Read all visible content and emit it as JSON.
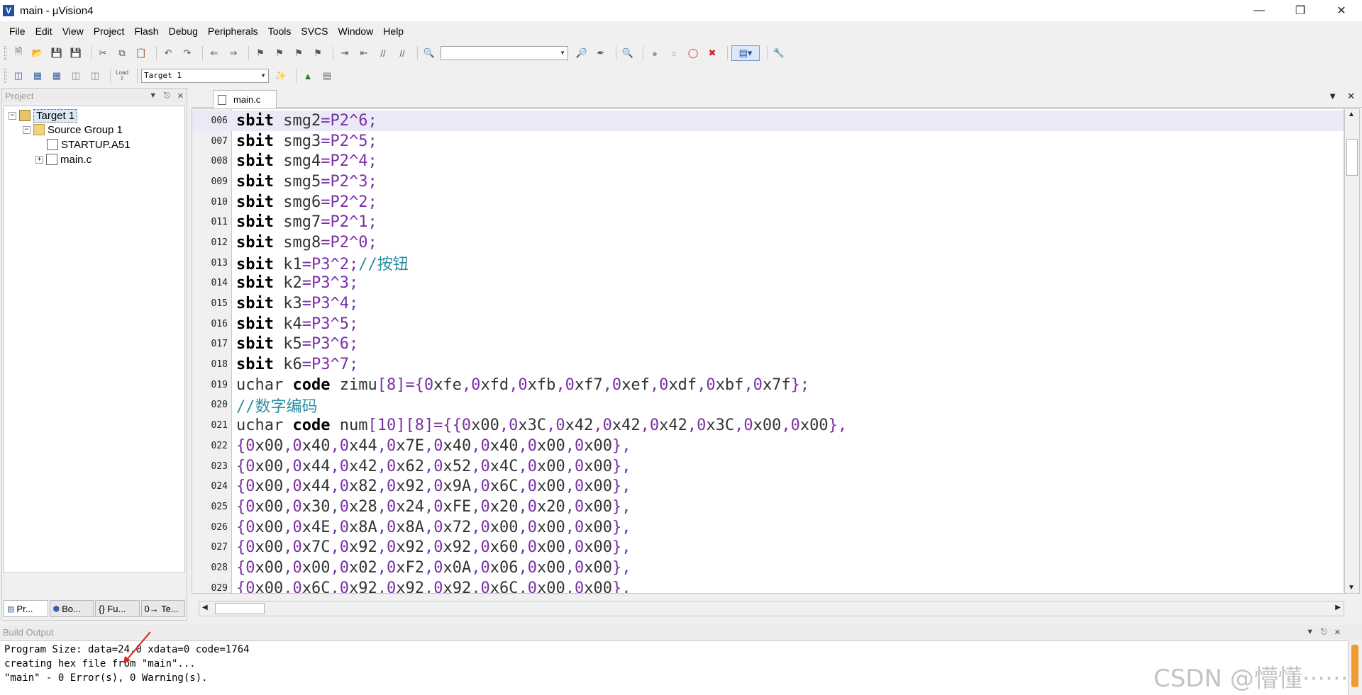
{
  "window": {
    "title": "main - µVision4",
    "app_icon": "V"
  },
  "menu": [
    "File",
    "Edit",
    "View",
    "Project",
    "Flash",
    "Debug",
    "Peripherals",
    "Tools",
    "SVCS",
    "Window",
    "Help"
  ],
  "toolbar2": {
    "load_label": "Load",
    "target_value": "Target 1"
  },
  "project_panel": {
    "title": "Project",
    "tree": {
      "target": "Target 1",
      "group": "Source Group 1",
      "files": [
        "STARTUP.A51",
        "main.c"
      ]
    },
    "tabs": [
      "Pr...",
      "Bo...",
      "{} Fu...",
      "0→ Te..."
    ]
  },
  "editor": {
    "tab": "main.c",
    "lines": [
      {
        "num": "006",
        "kw": "sbit",
        "rest": " smg2=P2^6;"
      },
      {
        "num": "007",
        "kw": "sbit",
        "rest": " smg3=P2^5;"
      },
      {
        "num": "008",
        "kw": "sbit",
        "rest": " smg4=P2^4;"
      },
      {
        "num": "009",
        "kw": "sbit",
        "rest": " smg5=P2^3;"
      },
      {
        "num": "010",
        "kw": "sbit",
        "rest": " smg6=P2^2;"
      },
      {
        "num": "011",
        "kw": "sbit",
        "rest": " smg7=P2^1;"
      },
      {
        "num": "012",
        "kw": "sbit",
        "rest": " smg8=P2^0;"
      },
      {
        "num": "013",
        "kw": "sbit",
        "rest": " k1=P3^2;",
        "comment": "//按钮"
      },
      {
        "num": "014",
        "kw": "sbit",
        "rest": " k2=P3^3;"
      },
      {
        "num": "015",
        "kw": "sbit",
        "rest": " k3=P3^4;"
      },
      {
        "num": "016",
        "kw": "sbit",
        "rest": " k4=P3^5;"
      },
      {
        "num": "017",
        "kw": "sbit",
        "rest": " k5=P3^6;"
      },
      {
        "num": "018",
        "kw": "sbit",
        "rest": " k6=P3^7;"
      },
      {
        "num": "019",
        "pre": "uchar ",
        "kw": "code",
        "rest": " zimu[8]={0xfe,0xfd,0xfb,0xf7,0xef,0xdf,0xbf,0x7f};"
      },
      {
        "num": "020",
        "comment": "//数字编码"
      },
      {
        "num": "021",
        "pre": "uchar ",
        "kw": "code",
        "rest": " num[10][8]={{0x00,0x3C,0x42,0x42,0x42,0x3C,0x00,0x00},"
      },
      {
        "num": "022",
        "rest": "{0x00,0x40,0x44,0x7E,0x40,0x40,0x00,0x00},"
      },
      {
        "num": "023",
        "rest": "{0x00,0x44,0x42,0x62,0x52,0x4C,0x00,0x00},"
      },
      {
        "num": "024",
        "rest": "{0x00,0x44,0x82,0x92,0x9A,0x6C,0x00,0x00},"
      },
      {
        "num": "025",
        "rest": "{0x00,0x30,0x28,0x24,0xFE,0x20,0x20,0x00},"
      },
      {
        "num": "026",
        "rest": "{0x00,0x4E,0x8A,0x8A,0x72,0x00,0x00,0x00},"
      },
      {
        "num": "027",
        "rest": "{0x00,0x7C,0x92,0x92,0x92,0x60,0x00,0x00},"
      },
      {
        "num": "028",
        "rest": "{0x00,0x00,0x02,0xF2,0x0A,0x06,0x00,0x00},"
      },
      {
        "num": "029",
        "rest": "{0x00,0x6C,0x92,0x92,0x92,0x6C,0x00,0x00},"
      }
    ]
  },
  "build_output": {
    "title": "Build Output",
    "lines": [
      "Program Size: data=24.0 xdata=0 code=1764",
      "creating hex file from \"main\"...",
      "\"main\" - 0 Error(s), 0 Warning(s)."
    ]
  },
  "watermark": "CSDN @懵懂······",
  "colors": {
    "keyword": "#000000",
    "operator": "#7b2fa5",
    "comment": "#2b8fa0",
    "current_line": "#eaeaf7",
    "scroll_accent": "#f39a32"
  }
}
